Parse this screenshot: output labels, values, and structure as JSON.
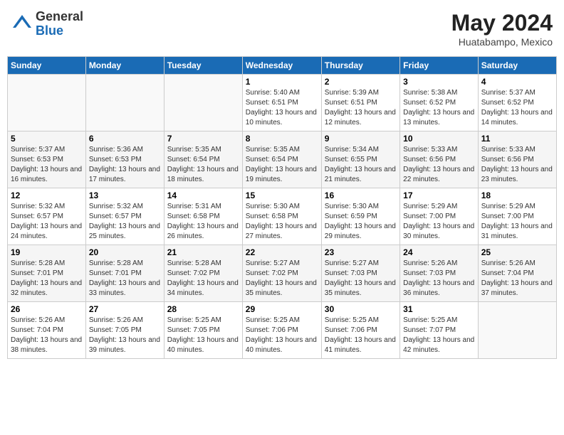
{
  "header": {
    "logo_general": "General",
    "logo_blue": "Blue",
    "month_year": "May 2024",
    "location": "Huatabampo, Mexico"
  },
  "days_of_week": [
    "Sunday",
    "Monday",
    "Tuesday",
    "Wednesday",
    "Thursday",
    "Friday",
    "Saturday"
  ],
  "weeks": [
    [
      {
        "day": "",
        "info": ""
      },
      {
        "day": "",
        "info": ""
      },
      {
        "day": "",
        "info": ""
      },
      {
        "day": "1",
        "info": "Sunrise: 5:40 AM\nSunset: 6:51 PM\nDaylight: 13 hours and 10 minutes."
      },
      {
        "day": "2",
        "info": "Sunrise: 5:39 AM\nSunset: 6:51 PM\nDaylight: 13 hours and 12 minutes."
      },
      {
        "day": "3",
        "info": "Sunrise: 5:38 AM\nSunset: 6:52 PM\nDaylight: 13 hours and 13 minutes."
      },
      {
        "day": "4",
        "info": "Sunrise: 5:37 AM\nSunset: 6:52 PM\nDaylight: 13 hours and 14 minutes."
      }
    ],
    [
      {
        "day": "5",
        "info": "Sunrise: 5:37 AM\nSunset: 6:53 PM\nDaylight: 13 hours and 16 minutes."
      },
      {
        "day": "6",
        "info": "Sunrise: 5:36 AM\nSunset: 6:53 PM\nDaylight: 13 hours and 17 minutes."
      },
      {
        "day": "7",
        "info": "Sunrise: 5:35 AM\nSunset: 6:54 PM\nDaylight: 13 hours and 18 minutes."
      },
      {
        "day": "8",
        "info": "Sunrise: 5:35 AM\nSunset: 6:54 PM\nDaylight: 13 hours and 19 minutes."
      },
      {
        "day": "9",
        "info": "Sunrise: 5:34 AM\nSunset: 6:55 PM\nDaylight: 13 hours and 21 minutes."
      },
      {
        "day": "10",
        "info": "Sunrise: 5:33 AM\nSunset: 6:56 PM\nDaylight: 13 hours and 22 minutes."
      },
      {
        "day": "11",
        "info": "Sunrise: 5:33 AM\nSunset: 6:56 PM\nDaylight: 13 hours and 23 minutes."
      }
    ],
    [
      {
        "day": "12",
        "info": "Sunrise: 5:32 AM\nSunset: 6:57 PM\nDaylight: 13 hours and 24 minutes."
      },
      {
        "day": "13",
        "info": "Sunrise: 5:32 AM\nSunset: 6:57 PM\nDaylight: 13 hours and 25 minutes."
      },
      {
        "day": "14",
        "info": "Sunrise: 5:31 AM\nSunset: 6:58 PM\nDaylight: 13 hours and 26 minutes."
      },
      {
        "day": "15",
        "info": "Sunrise: 5:30 AM\nSunset: 6:58 PM\nDaylight: 13 hours and 27 minutes."
      },
      {
        "day": "16",
        "info": "Sunrise: 5:30 AM\nSunset: 6:59 PM\nDaylight: 13 hours and 29 minutes."
      },
      {
        "day": "17",
        "info": "Sunrise: 5:29 AM\nSunset: 7:00 PM\nDaylight: 13 hours and 30 minutes."
      },
      {
        "day": "18",
        "info": "Sunrise: 5:29 AM\nSunset: 7:00 PM\nDaylight: 13 hours and 31 minutes."
      }
    ],
    [
      {
        "day": "19",
        "info": "Sunrise: 5:28 AM\nSunset: 7:01 PM\nDaylight: 13 hours and 32 minutes."
      },
      {
        "day": "20",
        "info": "Sunrise: 5:28 AM\nSunset: 7:01 PM\nDaylight: 13 hours and 33 minutes."
      },
      {
        "day": "21",
        "info": "Sunrise: 5:28 AM\nSunset: 7:02 PM\nDaylight: 13 hours and 34 minutes."
      },
      {
        "day": "22",
        "info": "Sunrise: 5:27 AM\nSunset: 7:02 PM\nDaylight: 13 hours and 35 minutes."
      },
      {
        "day": "23",
        "info": "Sunrise: 5:27 AM\nSunset: 7:03 PM\nDaylight: 13 hours and 35 minutes."
      },
      {
        "day": "24",
        "info": "Sunrise: 5:26 AM\nSunset: 7:03 PM\nDaylight: 13 hours and 36 minutes."
      },
      {
        "day": "25",
        "info": "Sunrise: 5:26 AM\nSunset: 7:04 PM\nDaylight: 13 hours and 37 minutes."
      }
    ],
    [
      {
        "day": "26",
        "info": "Sunrise: 5:26 AM\nSunset: 7:04 PM\nDaylight: 13 hours and 38 minutes."
      },
      {
        "day": "27",
        "info": "Sunrise: 5:26 AM\nSunset: 7:05 PM\nDaylight: 13 hours and 39 minutes."
      },
      {
        "day": "28",
        "info": "Sunrise: 5:25 AM\nSunset: 7:05 PM\nDaylight: 13 hours and 40 minutes."
      },
      {
        "day": "29",
        "info": "Sunrise: 5:25 AM\nSunset: 7:06 PM\nDaylight: 13 hours and 40 minutes."
      },
      {
        "day": "30",
        "info": "Sunrise: 5:25 AM\nSunset: 7:06 PM\nDaylight: 13 hours and 41 minutes."
      },
      {
        "day": "31",
        "info": "Sunrise: 5:25 AM\nSunset: 7:07 PM\nDaylight: 13 hours and 42 minutes."
      },
      {
        "day": "",
        "info": ""
      }
    ]
  ]
}
